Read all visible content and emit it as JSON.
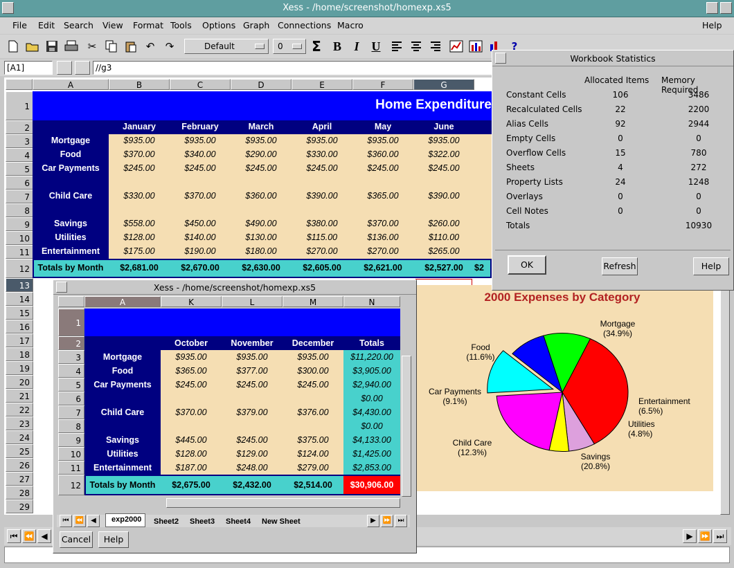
{
  "window": {
    "title": "Xess - /home/screenshot/homexp.xs5"
  },
  "menu": [
    "File",
    "Edit",
    "Search",
    "View",
    "Format",
    "Tools",
    "Options",
    "Graph",
    "Connections",
    "Macro",
    "Help"
  ],
  "toolbar": {
    "font_combo": "Default",
    "size_combo": "0",
    "sum": "Σ",
    "bold": "B",
    "italic": "I",
    "underline": "U",
    "help_glyph": "?"
  },
  "formula": {
    "cell_ref": "[A1]",
    "content": "//g3"
  },
  "main_sheet": {
    "columns": [
      "A",
      "B",
      "C",
      "D",
      "E",
      "F",
      "G"
    ],
    "rows": [
      "1",
      "2",
      "3",
      "4",
      "5",
      "6",
      "7",
      "8",
      "9",
      "10",
      "11",
      "12",
      "13",
      "14",
      "15",
      "16",
      "17",
      "18",
      "19",
      "20",
      "21",
      "22",
      "23",
      "24",
      "25",
      "26",
      "27",
      "28",
      "29"
    ],
    "title": "Home Expenditure",
    "months": [
      "January",
      "February",
      "March",
      "April",
      "May",
      "June"
    ],
    "categories": [
      "Mortgage",
      "Food",
      "Car Payments",
      "",
      "Child Care",
      "",
      "Savings",
      "Utilities",
      "Entertainment"
    ],
    "values": [
      [
        "$935.00",
        "$935.00",
        "$935.00",
        "$935.00",
        "$935.00",
        "$935.00"
      ],
      [
        "$370.00",
        "$340.00",
        "$290.00",
        "$330.00",
        "$360.00",
        "$322.00"
      ],
      [
        "$245.00",
        "$245.00",
        "$245.00",
        "$245.00",
        "$245.00",
        "$245.00"
      ],
      [
        "",
        "",
        "",
        "",
        "",
        ""
      ],
      [
        "$330.00",
        "$370.00",
        "$360.00",
        "$390.00",
        "$365.00",
        "$390.00"
      ],
      [
        "",
        "",
        "",
        "",
        "",
        ""
      ],
      [
        "$558.00",
        "$450.00",
        "$490.00",
        "$380.00",
        "$370.00",
        "$260.00"
      ],
      [
        "$128.00",
        "$140.00",
        "$130.00",
        "$115.00",
        "$136.00",
        "$110.00"
      ],
      [
        "$175.00",
        "$190.00",
        "$180.00",
        "$270.00",
        "$270.00",
        "$265.00"
      ]
    ],
    "totals_label": "Totals by Month",
    "totals": [
      "$2,681.00",
      "$2,670.00",
      "$2,630.00",
      "$2,605.00",
      "$2,621.00",
      "$2,527.00",
      "$2"
    ]
  },
  "chart": {
    "title": "2000 Expenses by Category",
    "slices": [
      {
        "name": "Mortgage",
        "pct": "(34.9%)",
        "value": 34.9,
        "color": "#ff0000"
      },
      {
        "name": "Entertainment",
        "pct": "(6.5%)",
        "value": 6.5,
        "color": "#dda0dd"
      },
      {
        "name": "Utilities",
        "pct": "(4.8%)",
        "value": 4.8,
        "color": "#ffff00"
      },
      {
        "name": "Savings",
        "pct": "(20.8%)",
        "value": 20.8,
        "color": "#ff00ff"
      },
      {
        "name": "Child Care",
        "pct": "(12.3%)",
        "value": 12.3,
        "color": "#00ffff"
      },
      {
        "name": "Car Payments",
        "pct": "(9.1%)",
        "value": 9.1,
        "color": "#0000ff"
      },
      {
        "name": "Food",
        "pct": "(11.6%)",
        "value": 11.6,
        "color": "#00ff00"
      }
    ]
  },
  "stats_dialog": {
    "title": "Workbook Statistics",
    "col1": "Allocated Items",
    "col2": "Memory Required",
    "rows": [
      {
        "label": "Constant Cells",
        "items": "106",
        "mem": "3486"
      },
      {
        "label": "Recalculated Cells",
        "items": "22",
        "mem": "2200"
      },
      {
        "label": "Alias Cells",
        "items": "92",
        "mem": "2944"
      },
      {
        "label": "Empty Cells",
        "items": "0",
        "mem": "0"
      },
      {
        "label": "Overflow Cells",
        "items": "15",
        "mem": "780"
      },
      {
        "label": "Sheets",
        "items": "4",
        "mem": "272"
      },
      {
        "label": "Property Lists",
        "items": "24",
        "mem": "1248"
      },
      {
        "label": "Overlays",
        "items": "0",
        "mem": "0"
      },
      {
        "label": "Cell Notes",
        "items": "0",
        "mem": "0"
      },
      {
        "label": "Totals",
        "items": "",
        "mem": "10930"
      }
    ],
    "ok": "OK",
    "refresh": "Refresh",
    "help": "Help"
  },
  "sub_window": {
    "title": "Xess - /home/screenshot/homexp.xs5",
    "columns": [
      "A",
      "K",
      "L",
      "M",
      "N"
    ],
    "rows": [
      "1",
      "2",
      "3",
      "4",
      "5",
      "6",
      "7",
      "8",
      "9",
      "10",
      "11",
      "12"
    ],
    "months": [
      "October",
      "November",
      "December",
      "Totals"
    ],
    "categories": [
      "Mortgage",
      "Food",
      "Car Payments",
      "",
      "Child Care",
      "",
      "Savings",
      "Utilities",
      "Entertainment"
    ],
    "values": [
      [
        "$935.00",
        "$935.00",
        "$935.00",
        "$11,220.00"
      ],
      [
        "$365.00",
        "$377.00",
        "$300.00",
        "$3,905.00"
      ],
      [
        "$245.00",
        "$245.00",
        "$245.00",
        "$2,940.00"
      ],
      [
        "",
        "",
        "",
        "$0.00"
      ],
      [
        "$370.00",
        "$379.00",
        "$376.00",
        "$4,430.00"
      ],
      [
        "",
        "",
        "",
        "$0.00"
      ],
      [
        "$445.00",
        "$245.00",
        "$375.00",
        "$4,133.00"
      ],
      [
        "$128.00",
        "$129.00",
        "$124.00",
        "$1,425.00"
      ],
      [
        "$187.00",
        "$248.00",
        "$279.00",
        "$2,853.00"
      ]
    ],
    "totals_label": "Totals by Month",
    "totals": [
      "$2,675.00",
      "$2,432.00",
      "$2,514.00",
      "$30,906.00"
    ],
    "tabs": [
      "exp2000",
      "Sheet2",
      "Sheet3",
      "Sheet4",
      "New Sheet"
    ],
    "cancel": "Cancel",
    "help": "Help"
  }
}
